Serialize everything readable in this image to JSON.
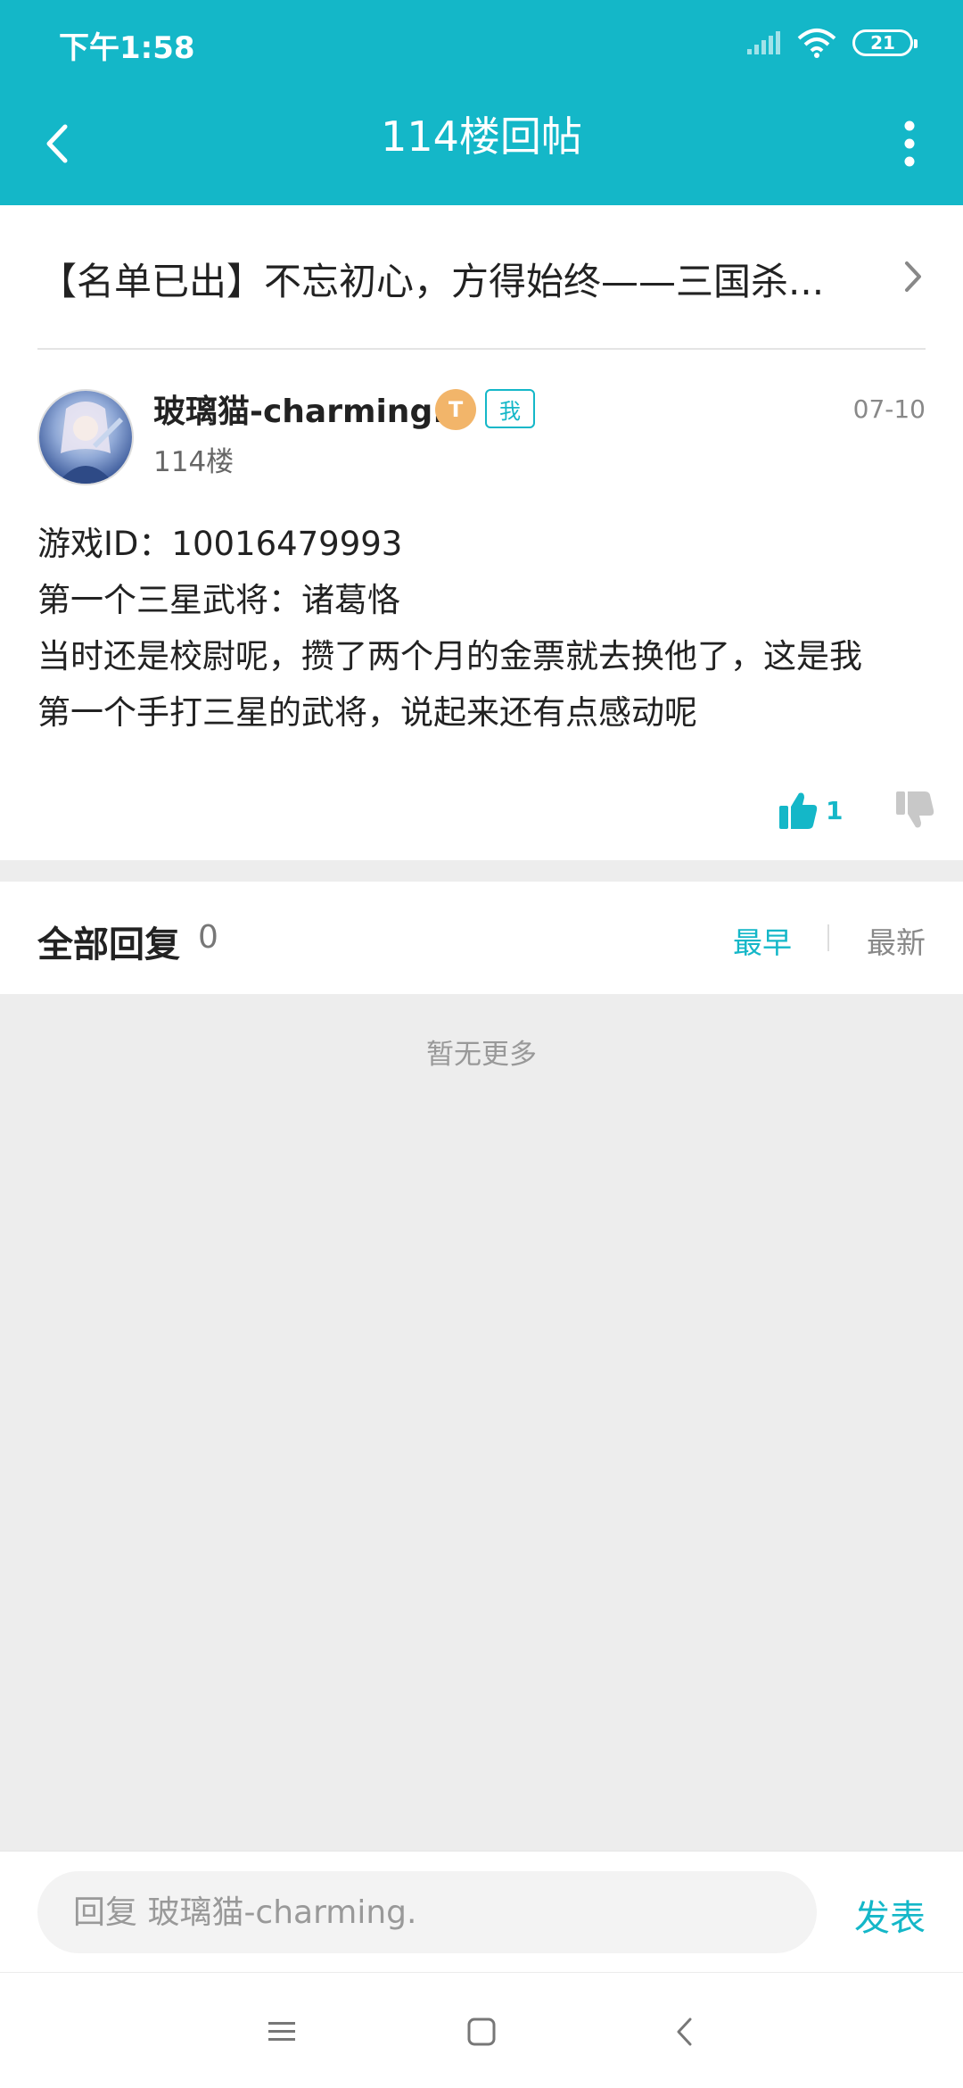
{
  "status_bar": {
    "time": "下午1:58",
    "battery": "21"
  },
  "app_bar": {
    "title": "114楼回帖"
  },
  "thread": {
    "title": "【名单已出】不忘初心，方得始终——三国杀..."
  },
  "post": {
    "user_name": "玻璃猫-charming.",
    "level_badge": "T",
    "me_badge": "我",
    "date": "07-10",
    "floor": "114楼",
    "body_lines": [
      "游戏ID：10016479993",
      "第一个三星武将：诸葛恪",
      "当时还是校尉呢，攒了两个月的金票就去换他了，这是我",
      "第一个手打三星的武将，说起来还有点感动呢"
    ],
    "like_count": "1"
  },
  "replies": {
    "title": "全部回复",
    "count": "0",
    "sort_earliest": "最早",
    "sort_newest": "最新",
    "empty_text": "暂无更多"
  },
  "reply_bar": {
    "placeholder": "回复 玻璃猫-charming.",
    "publish_label": "发表"
  },
  "colors": {
    "accent": "#14b7c8",
    "background": "#ededed",
    "text": "#222222"
  },
  "icons": [
    "back-arrow-icon",
    "more-vertical-icon",
    "chevron-right-icon",
    "thumbs-up-icon",
    "thumbs-down-icon",
    "menu-icon",
    "home-icon",
    "nav-back-icon",
    "signal-icon",
    "wifi-icon",
    "battery-icon"
  ]
}
